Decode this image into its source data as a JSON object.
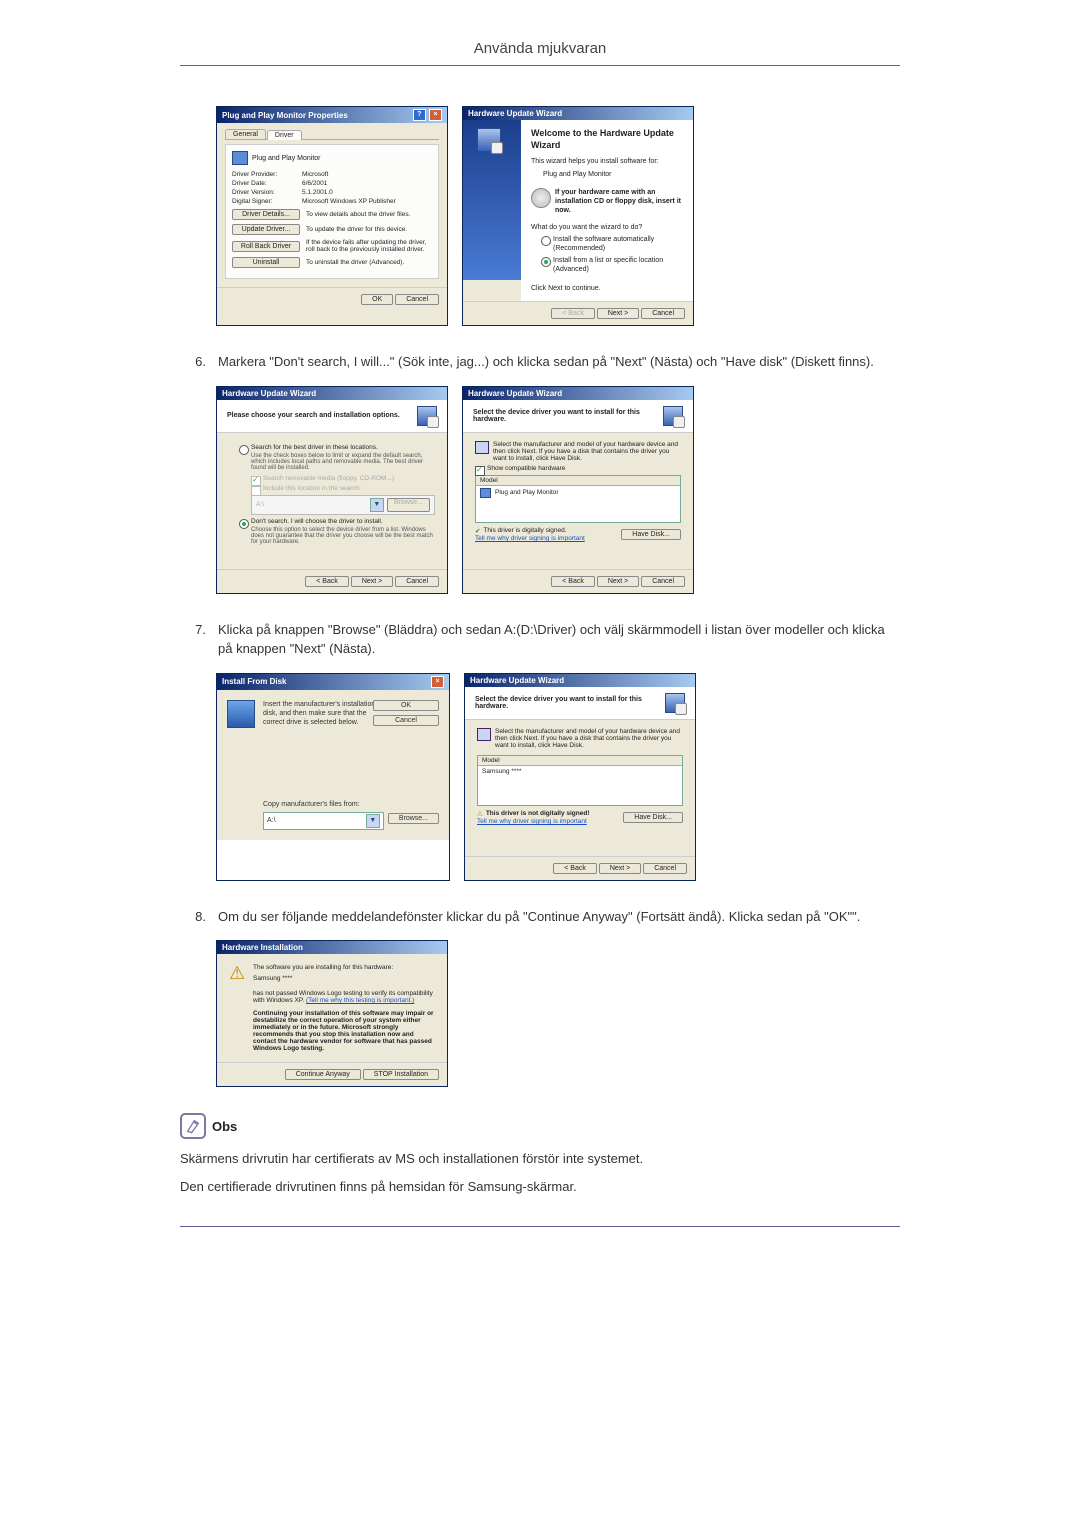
{
  "page_title": "Använda mjukvaran",
  "steps": {
    "s6": {
      "num": "6.",
      "text": "Markera \"Don't search, I will...\" (Sök inte, jag...) och klicka sedan på \"Next\" (Nästa) och \"Have disk\" (Diskett finns)."
    },
    "s7": {
      "num": "7.",
      "text": "Klicka på knappen \"Browse\" (Bläddra) och sedan A:(D:\\Driver) och välj skärmmodell i listan över modeller och klicka på knappen \"Next\" (Nästa)."
    },
    "s8": {
      "num": "8.",
      "text": "Om du ser följande meddelandefönster klickar du på \"Continue Anyway\" (Fortsätt ändå). Klicka sedan på \"OK\"\"."
    }
  },
  "obs_label": "Obs",
  "obs_p1": "Skärmens drivrutin har certifierats av MS och installationen förstör inte systemet.",
  "obs_p2": "Den certifierade drivrutinen finns på hemsidan för Samsung-skärmar.",
  "common_buttons": {
    "ok": "OK",
    "cancel": "Cancel",
    "back": "< Back",
    "next": "Next >",
    "browse": "Browse...",
    "have_disk": "Have Disk..."
  },
  "dlg_props": {
    "title": "Plug and Play Monitor Properties",
    "tabs": [
      "General",
      "Driver"
    ],
    "device_name": "Plug and Play Monitor",
    "rows": {
      "provider_lbl": "Driver Provider:",
      "provider_val": "Microsoft",
      "date_lbl": "Driver Date:",
      "date_val": "6/6/2001",
      "version_lbl": "Driver Version:",
      "version_val": "5.1.2001.0",
      "signer_lbl": "Digital Signer:",
      "signer_val": "Microsoft Windows XP Publisher"
    },
    "btns": {
      "details": "Driver Details...",
      "details_desc": "To view details about the driver files.",
      "update": "Update Driver...",
      "update_desc": "To update the driver for this device.",
      "rollback": "Roll Back Driver",
      "rollback_desc": "If the device fails after updating the driver, roll back to the previously installed driver.",
      "uninstall": "Uninstall",
      "uninstall_desc": "To uninstall the driver (Advanced)."
    }
  },
  "dlg_hw_welcome": {
    "title": "Hardware Update Wizard",
    "heading": "Welcome to the Hardware Update Wizard",
    "line1": "This wizard helps you install software for:",
    "device": "Plug and Play Monitor",
    "cd_hint": "If your hardware came with an installation CD or floppy disk, insert it now.",
    "question": "What do you want the wizard to do?",
    "opt_auto": "Install the software automatically (Recommended)",
    "opt_list": "Install from a list or specific location (Advanced)",
    "continue": "Click Next to continue."
  },
  "dlg_search_opts": {
    "title": "Hardware Update Wizard",
    "heading": "Please choose your search and installation options.",
    "opt_search": "Search for the best driver in these locations.",
    "opt_search_note": "Use the check boxes below to limit or expand the default search, which includes local paths and removable media. The best driver found will be installed.",
    "chk_removable": "Search removable media (floppy, CD-ROM...)",
    "chk_include": "Include this location in the search:",
    "path": "A:\\",
    "opt_dont": "Don't search. I will choose the driver to install.",
    "opt_dont_note": "Choose this option to select the device driver from a list. Windows does not guarantee that the driver you choose will be the best match for your hardware."
  },
  "dlg_select_driver": {
    "title": "Hardware Update Wizard",
    "heading": "Select the device driver you want to install for this hardware.",
    "instruction": "Select the manufacturer and model of your hardware device and then click Next. If you have a disk that contains the driver you want to install, click Have Disk.",
    "show_compat": "Show compatible hardware",
    "model_header": "Model",
    "model_item": "Plug and Play Monitor",
    "signed": "This driver is digitally signed.",
    "signing_link": "Tell me why driver signing is important"
  },
  "dlg_install_disk": {
    "title": "Install From Disk",
    "text": "Insert the manufacturer's installation disk, and then make sure that the correct drive is selected below.",
    "copy_from": "Copy manufacturer's files from:",
    "path": "A:\\"
  },
  "dlg_select_driver2": {
    "title": "Hardware Update Wizard",
    "heading": "Select the device driver you want to install for this hardware.",
    "instruction": "Select the manufacturer and model of your hardware device and then click Next. If you have a disk that contains the driver you want to install, click Have Disk.",
    "model_header": "Model",
    "model_item": "Samsung ****",
    "unsigned": "This driver is not digitally signed!",
    "signing_link": "Tell me why driver signing is important"
  },
  "dlg_hw_install": {
    "title": "Hardware Installation",
    "line1": "The software you are installing for this hardware:",
    "device": "Samsung ****",
    "line2a": "has not passed Windows Logo testing to verify its compatibility with Windows XP. ",
    "line2b": "(Tell me why this testing is important.)",
    "warn": "Continuing your installation of this software may impair or destabilize the correct operation of your system either immediately or in the future. Microsoft strongly recommends that you stop this installation now and contact the hardware vendor for software that has passed Windows Logo testing.",
    "btn_continue": "Continue Anyway",
    "btn_stop": "STOP Installation"
  }
}
